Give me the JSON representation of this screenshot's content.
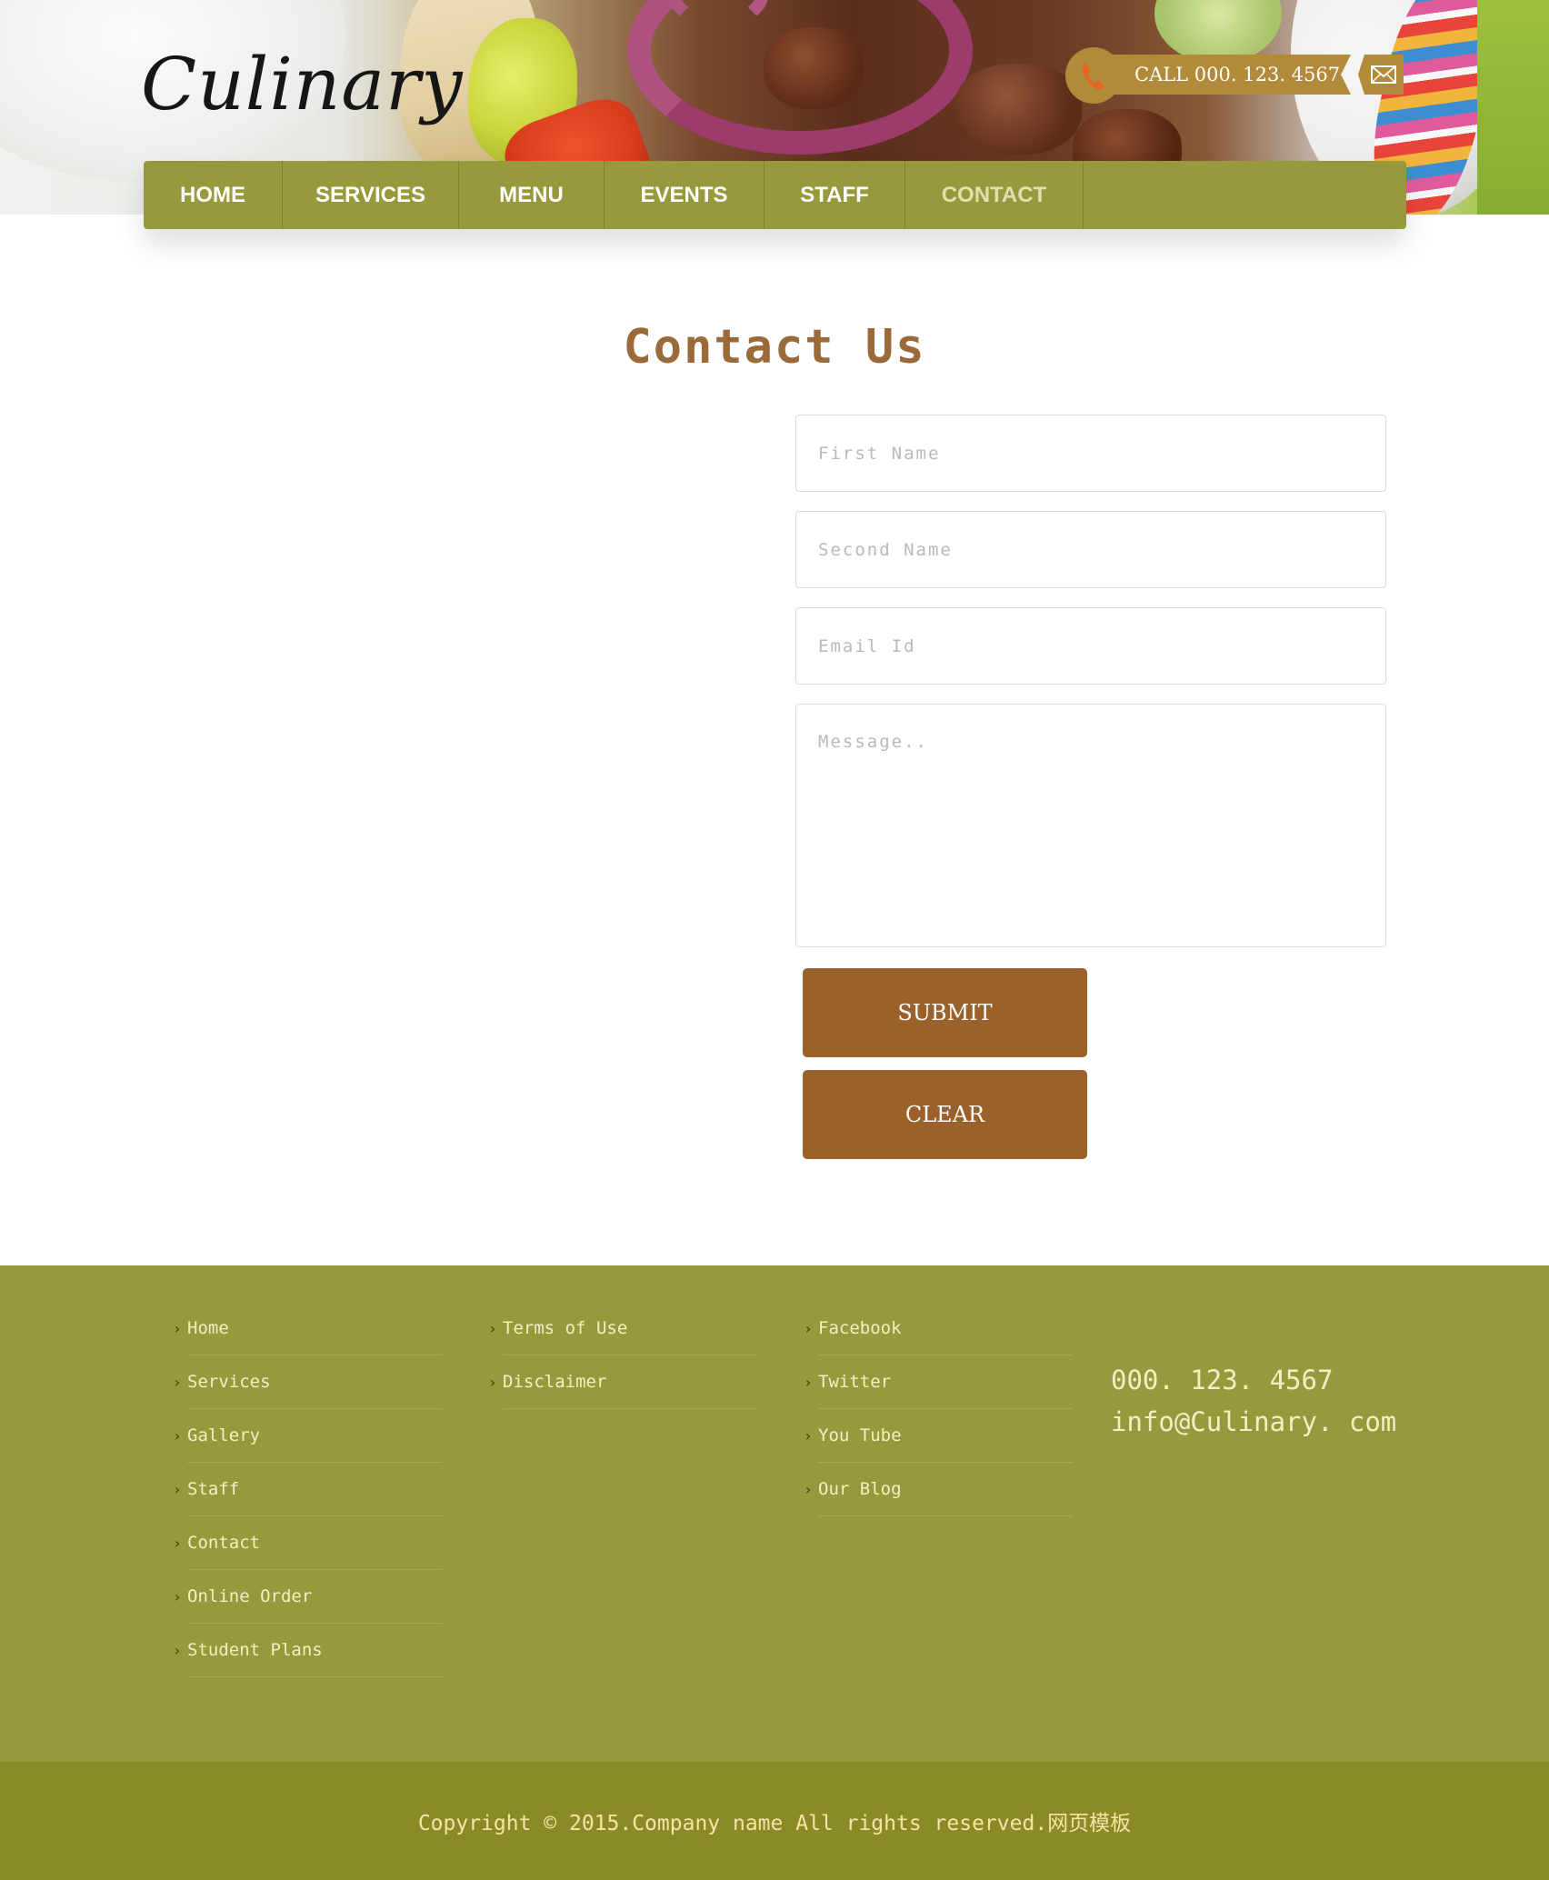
{
  "header": {
    "logo": "Culinary",
    "call_text": "CALL  000. 123. 4567",
    "phone_icon": "phone-icon",
    "mail_icon": "mail-icon"
  },
  "nav": {
    "items": [
      {
        "label": "HOME"
      },
      {
        "label": "SERVICES"
      },
      {
        "label": "MENU"
      },
      {
        "label": "EVENTS"
      },
      {
        "label": "STAFF"
      },
      {
        "label": "CONTACT",
        "active": true
      }
    ]
  },
  "main": {
    "title": "Contact Us",
    "form": {
      "first_name_placeholder": "First Name",
      "second_name_placeholder": "Second Name",
      "email_placeholder": "Email Id",
      "message_placeholder": "Message..",
      "submit_label": "SUBMIT",
      "clear_label": "CLEAR"
    }
  },
  "footer": {
    "col1": [
      "Home",
      "Services",
      "Gallery",
      "Staff",
      "Contact",
      "Online Order",
      "Student Plans"
    ],
    "col2": [
      "Terms of Use",
      "Disclaimer"
    ],
    "col3": [
      "Facebook",
      "Twitter",
      "You Tube",
      "Our Blog"
    ],
    "phone": "000. 123. 4567",
    "email": "info@Culinary. com",
    "copyright": "Copyright © 2015.Company name All rights reserved.网页模板"
  },
  "colors": {
    "accent_olive": "#98993d",
    "accent_brown": "#9a612b",
    "title_brown": "#9a6a3a",
    "bottom_bar": "#8a8a26"
  }
}
